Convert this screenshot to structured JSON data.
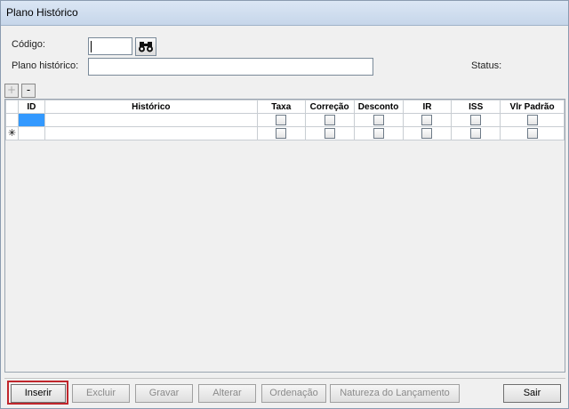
{
  "window": {
    "title": "Plano Histórico"
  },
  "form": {
    "codigo_label": "Código:",
    "codigo_value": "",
    "plano_label": "Plano histórico:",
    "plano_value": "",
    "status_label": "Status:"
  },
  "grid": {
    "add_label": "+",
    "remove_label": "-",
    "columns": [
      "ID",
      "Histórico",
      "Taxa",
      "Correção",
      "Desconto",
      "IR",
      "ISS",
      "Vlr Padrão"
    ],
    "new_row_marker": "✳"
  },
  "buttons": {
    "inserir": "Inserir",
    "excluir": "Excluir",
    "gravar": "Gravar",
    "alterar": "Alterar",
    "ordenacao": "Ordenação",
    "natureza": "Natureza do Lançamento",
    "sair": "Sair"
  },
  "colors": {
    "highlight": "#c0262c",
    "selected_cell": "#3399ff"
  }
}
